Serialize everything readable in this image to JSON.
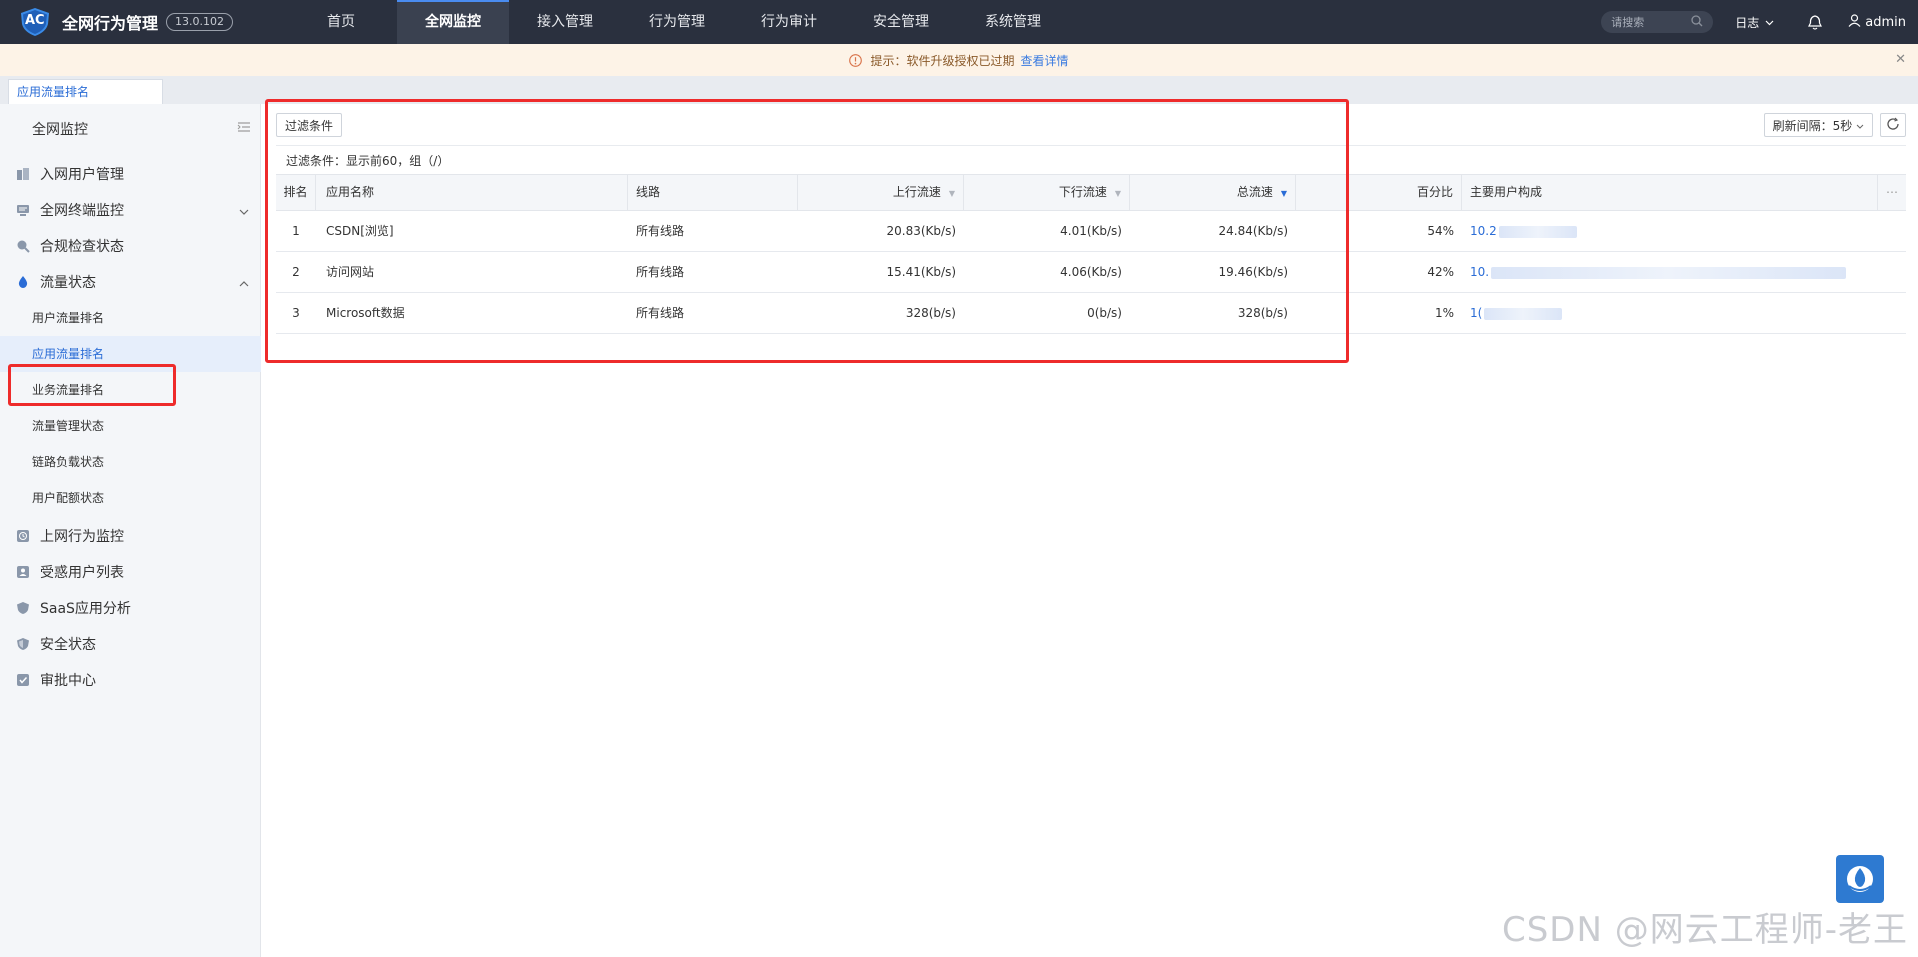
{
  "app": {
    "title": "全网行为管理",
    "version": "13.0.102",
    "logo_text": "AC"
  },
  "nav": {
    "items": [
      "首页",
      "全网监控",
      "接入管理",
      "行为管理",
      "行为审计",
      "安全管理",
      "系统管理"
    ],
    "active": "全网监控"
  },
  "top_right": {
    "search_placeholder": "请搜索",
    "log_label": "日志",
    "user": "admin"
  },
  "notice": {
    "text": "提示：软件升级授权已过期",
    "link": "查看详情"
  },
  "tabs": [
    "应用流量排名"
  ],
  "sidebar": {
    "header": "全网监控",
    "items": {
      "access_user": "入网用户管理",
      "terminal": "全网终端监控",
      "compliance": "合规检查状态",
      "traffic": "流量状态",
      "online_behavior": "上网行为监控",
      "infected": "受惑用户列表",
      "saas": "SaaS应用分析",
      "security": "安全状态",
      "approval": "审批中心"
    },
    "sub_items": [
      "用户流量排名",
      "应用流量排名",
      "业务流量排名",
      "流量管理状态",
      "链路负载状态",
      "用户配额状态"
    ],
    "active_sub": "应用流量排名"
  },
  "toolbar": {
    "filter_button": "过滤条件",
    "refresh_label": "刷新间隔：5秒",
    "filter_summary": "过滤条件：显示前60，组（/）"
  },
  "table": {
    "columns": [
      "排名",
      "应用名称",
      "线路",
      "上行流速",
      "下行流速",
      "总流速",
      "百分比",
      "主要用户构成"
    ],
    "rows": [
      {
        "rank": "1",
        "app": "CSDN[浏览]",
        "line": "所有线路",
        "up": "20.83(Kb/s)",
        "down": "4.01(Kb/s)",
        "total": "24.84(Kb/s)",
        "pct": "54%",
        "users": "10.2"
      },
      {
        "rank": "2",
        "app": "访问网站",
        "line": "所有线路",
        "up": "15.41(Kb/s)",
        "down": "4.06(Kb/s)",
        "total": "19.46(Kb/s)",
        "pct": "42%",
        "users": "10."
      },
      {
        "rank": "3",
        "app": "Microsoft数据",
        "line": "所有线路",
        "up": "328(b/s)",
        "down": "0(b/s)",
        "total": "328(b/s)",
        "pct": "1%",
        "users": "1("
      }
    ]
  },
  "watermark": "CSDN @网云工程师-老王"
}
